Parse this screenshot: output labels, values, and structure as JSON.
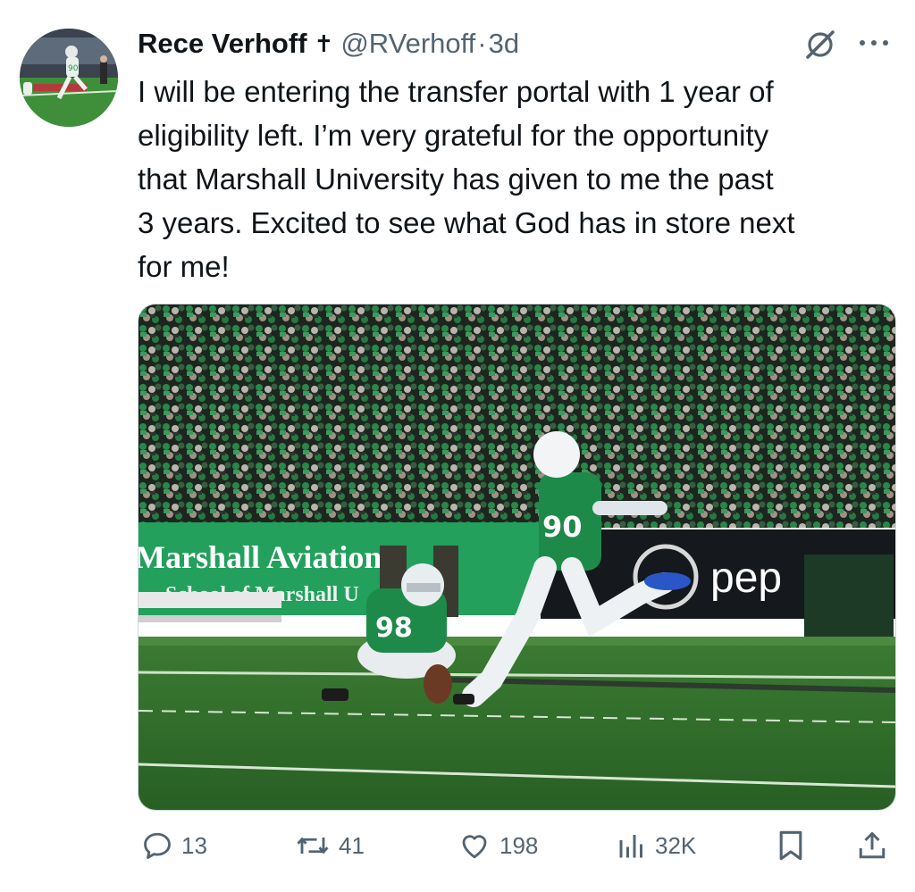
{
  "tweet": {
    "author_name": "Rece Verhoff",
    "author_emoji": "✝",
    "handle": "@RVerhoff",
    "separator": "·",
    "time_ago": "3d",
    "text": "I will be entering the transfer portal with 1 year of\neligibility left. I’m very grateful for the opportunity\nthat Marshall University has given to me the past\n3 years. Excited to see what God has in store next\nfor me!"
  },
  "media": {
    "banner_text_1": "Marshall Aviation",
    "banner_text_2": "School of Marshall U",
    "sponsor_text": "pep",
    "jersey_kicker": "90",
    "jersey_holder": "98"
  },
  "actions": {
    "replies": "13",
    "reposts": "41",
    "likes": "198",
    "views": "32K"
  },
  "icons": [
    "grok-icon",
    "more-icon",
    "reply-icon",
    "repost-icon",
    "like-icon",
    "views-icon",
    "bookmark-icon",
    "share-icon",
    "cross-emoji-icon"
  ],
  "colors": {
    "text": "#0f1419",
    "secondary": "#536471",
    "marshall_green": "#1e9a4f",
    "field": "#2f6e2e"
  }
}
